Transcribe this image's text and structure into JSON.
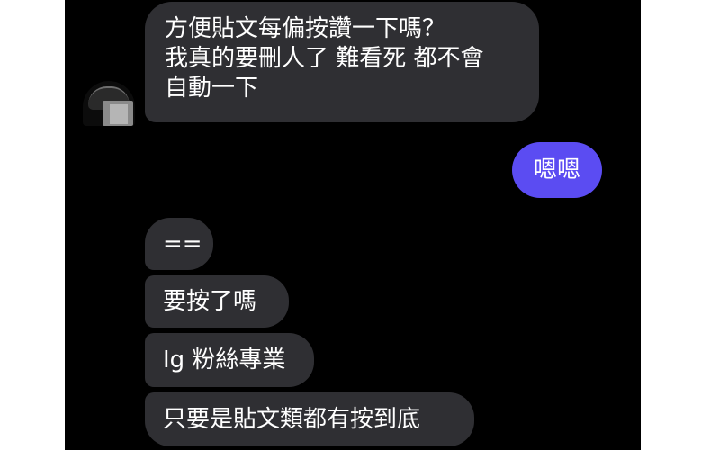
{
  "messages": [
    {
      "sender": "other",
      "lines": [
        "方便貼文每偏按讚一下嗎？",
        "我真的要刪人了 難看死 都不會",
        "自動一下"
      ]
    },
    {
      "sender": "me",
      "text": "嗯嗯"
    },
    {
      "sender": "other",
      "text": "=="
    },
    {
      "sender": "other",
      "text": "要按了嗎"
    },
    {
      "sender": "other",
      "text": "Ig 粉絲專業"
    },
    {
      "sender": "other",
      "text": "只要是貼文類都有按到底"
    }
  ],
  "colors": {
    "background": "#000000",
    "received_bubble": "#2f2f33",
    "sent_bubble": "#5b4cf2",
    "text": "#ffffff"
  },
  "avatar": {
    "icon": "avatar-icon",
    "obscured": true
  }
}
